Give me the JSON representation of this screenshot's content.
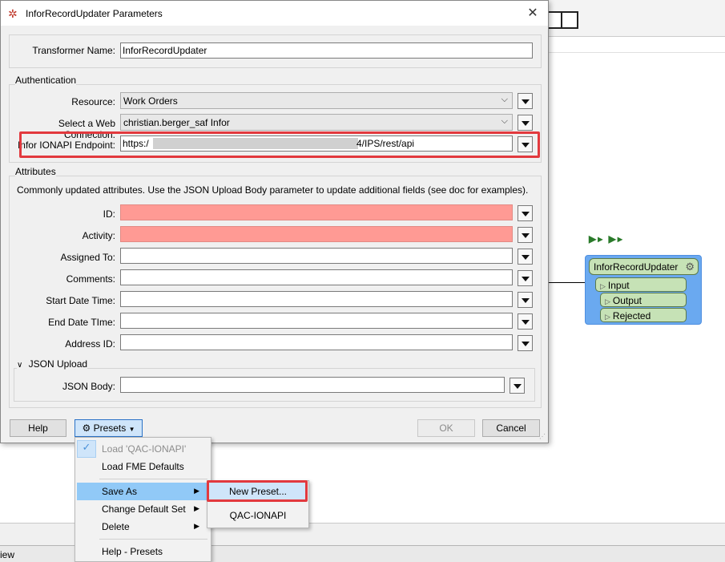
{
  "dialog": {
    "title": "InforRecordUpdater Parameters",
    "transformer_name_label": "Transformer Name:",
    "transformer_name_value": "InforRecordUpdater",
    "auth_group_label": "Authentication",
    "resource_label": "Resource:",
    "resource_value": "Work Orders",
    "connection_label": "Select a Web Connection:",
    "connection_value": "christian.berger_saf Infor",
    "endpoint_label": "Infor IONAPI Endpoint:",
    "endpoint_prefix": "https:/",
    "endpoint_suffix": "4/IPS/rest/api",
    "attributes_group_label": "Attributes",
    "attributes_description": "Commonly updated attributes. Use the JSON Upload Body parameter to update additional fields (see doc for examples).",
    "fields": [
      {
        "label": "ID:",
        "value": "",
        "required": true
      },
      {
        "label": "Activity:",
        "value": "",
        "required": true
      },
      {
        "label": "Assigned To:",
        "value": "",
        "required": false
      },
      {
        "label": "Comments:",
        "value": "",
        "required": false
      },
      {
        "label": "Start Date Time:",
        "value": "",
        "required": false
      },
      {
        "label": "End Date TIme:",
        "value": "",
        "required": false
      },
      {
        "label": "Address ID:",
        "value": "",
        "required": false
      }
    ],
    "json_group_label": "JSON Upload",
    "json_body_label": "JSON Body:",
    "json_body_value": "",
    "help_label": "Help",
    "presets_label": "Presets",
    "ok_label": "OK",
    "cancel_label": "Cancel"
  },
  "presets_menu": {
    "items": [
      {
        "label": "Load 'QAC-IONAPI'",
        "disabled": true,
        "checked": true
      },
      {
        "label": "Load FME Defaults"
      },
      {
        "label": "Save As",
        "submenu": true,
        "active": true
      },
      {
        "label": "Change Default Set",
        "submenu": true
      },
      {
        "label": "Delete",
        "submenu": true
      },
      {
        "label": "Help - Presets"
      }
    ]
  },
  "save_as_submenu": {
    "items": [
      {
        "label": "New Preset...",
        "highlighted": true
      },
      {
        "label": "QAC-IONAPI"
      }
    ]
  },
  "canvas": {
    "node_title": "InforRecordUpdater",
    "input_port": "Input",
    "output_ports": [
      "Output",
      "Rejected"
    ],
    "status_text": "iew"
  },
  "colors": {
    "required_field": "#ff9a94",
    "highlight": "#e2393e",
    "node_bg": "#6aa9f0",
    "port_bg": "#c6e2b6",
    "menu_active": "#91c9f7"
  }
}
